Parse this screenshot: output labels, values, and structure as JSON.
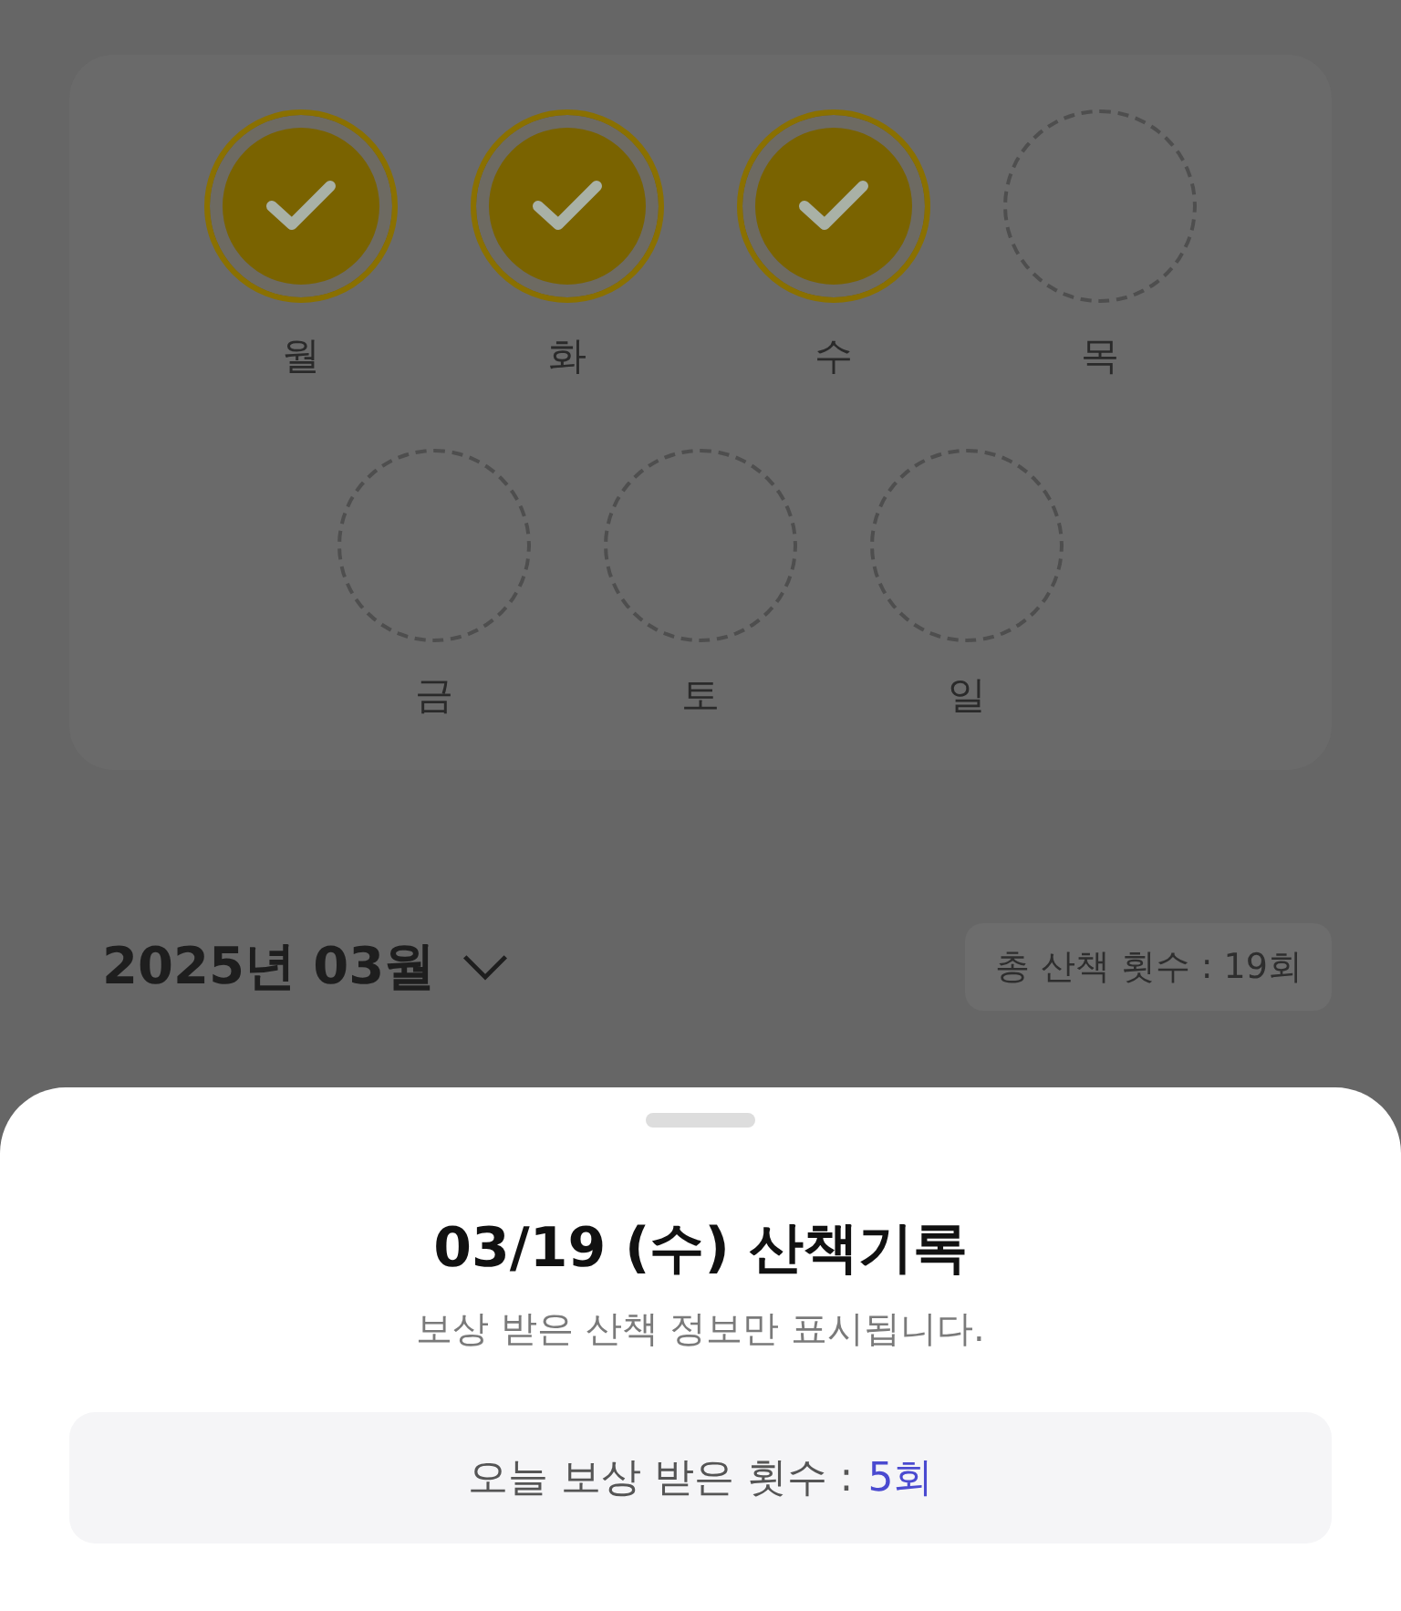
{
  "week": {
    "days": [
      {
        "label": "월",
        "checked": true
      },
      {
        "label": "화",
        "checked": true
      },
      {
        "label": "수",
        "checked": true
      },
      {
        "label": "목",
        "checked": false
      },
      {
        "label": "금",
        "checked": false
      },
      {
        "label": "토",
        "checked": false
      },
      {
        "label": "일",
        "checked": false
      }
    ]
  },
  "month": {
    "title": "2025년 03월",
    "total": "총 산책 횟수 : 19회"
  },
  "sheet": {
    "title": "03/19 (수) 산책기록",
    "subtitle": "보상 받은 산책 정보만 표시됩니다.",
    "summary_label": "오늘 보상 받은 횟수 :",
    "summary_value": "5회"
  }
}
